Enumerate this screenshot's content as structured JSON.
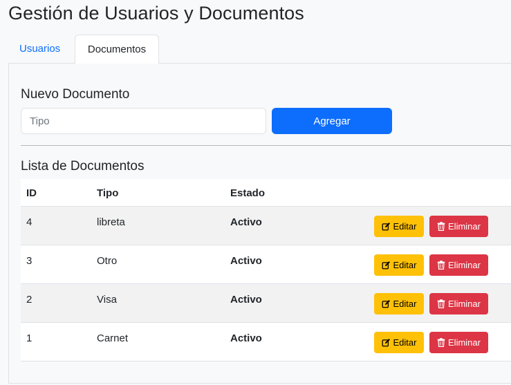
{
  "page": {
    "title": "Gestión de Usuarios y Documentos"
  },
  "tabs": [
    {
      "label": "Usuarios",
      "active": false
    },
    {
      "label": "Documentos",
      "active": true
    }
  ],
  "form": {
    "title": "Nuevo Documento",
    "input_placeholder": "Tipo",
    "input_value": "",
    "submit_label": "Agregar"
  },
  "list": {
    "title": "Lista de Documentos",
    "headers": {
      "id": "ID",
      "tipo": "Tipo",
      "estado": "Estado"
    },
    "rows": [
      {
        "id": "4",
        "tipo": "libreta",
        "estado": "Activo"
      },
      {
        "id": "3",
        "tipo": "Otro",
        "estado": "Activo"
      },
      {
        "id": "2",
        "tipo": "Visa",
        "estado": "Activo"
      },
      {
        "id": "1",
        "tipo": "Carnet",
        "estado": "Activo"
      }
    ],
    "edit_label": "Editar",
    "delete_label": "Eliminar",
    "edit_icon": "edit-icon",
    "delete_icon": "trash-icon"
  },
  "colors": {
    "primary": "#0d6efd",
    "warning": "#ffc107",
    "danger": "#dc3545"
  }
}
